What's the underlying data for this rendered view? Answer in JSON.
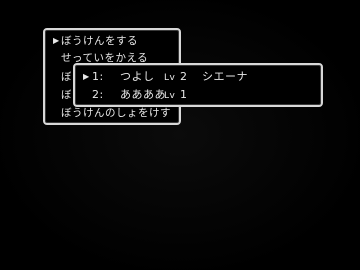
{
  "main_menu": {
    "cursor": "▶",
    "items": [
      "ぼうけんをする",
      "せっていをかえる",
      "ぼ",
      "ぼ",
      "ぼうけんのしょをけす"
    ]
  },
  "save_slots": {
    "cursor": "▶",
    "slots": [
      {
        "number": "1:",
        "name": "つよし",
        "level_label": "Lv",
        "level": "2",
        "location": "シエーナ"
      },
      {
        "number": "2:",
        "name": "ああああ",
        "level_label": "Lv",
        "level": "1",
        "location": ""
      }
    ]
  }
}
